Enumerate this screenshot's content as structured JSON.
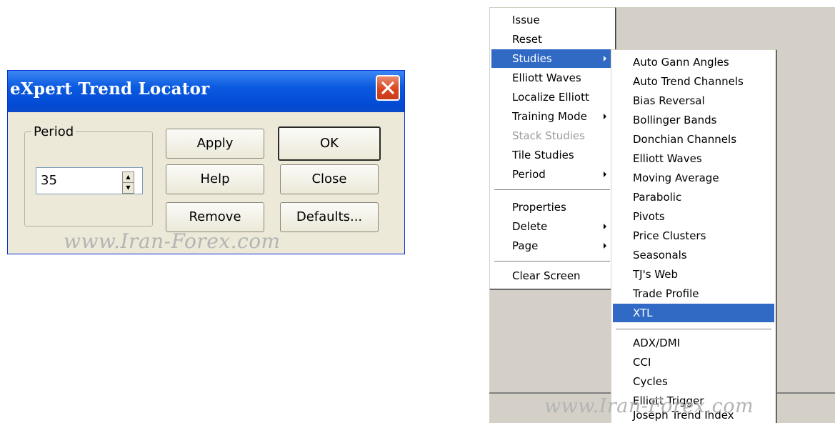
{
  "dialog": {
    "title": "eXpert Trend Locator",
    "period_group_label": "Period",
    "period_value": "35",
    "buttons": {
      "apply": "Apply",
      "ok": "OK",
      "help": "Help",
      "close": "Close",
      "remove": "Remove",
      "defaults": "Defaults..."
    },
    "watermark": "www.Iran-Forex.com"
  },
  "context_menu": {
    "items": [
      {
        "label": "Issue"
      },
      {
        "label": "Reset"
      },
      {
        "label": "Studies",
        "selected": true,
        "submenu": true
      },
      {
        "label": "Elliott Waves"
      },
      {
        "label": "Localize Elliott"
      },
      {
        "label": "Training Mode",
        "submenu": true
      },
      {
        "label": "Stack Studies",
        "disabled": true
      },
      {
        "label": "Tile Studies"
      },
      {
        "label": "Period",
        "submenu": true
      },
      {
        "label": "Properties"
      },
      {
        "label": "Delete",
        "submenu": true
      },
      {
        "label": "Page",
        "submenu": true
      },
      {
        "label": "Clear Screen"
      }
    ]
  },
  "studies_submenu": {
    "items": [
      {
        "label": "Auto Gann Angles"
      },
      {
        "label": "Auto Trend Channels"
      },
      {
        "label": "Bias Reversal"
      },
      {
        "label": "Bollinger Bands"
      },
      {
        "label": "Donchian Channels"
      },
      {
        "label": "Elliott Waves"
      },
      {
        "label": "Moving Average"
      },
      {
        "label": "Parabolic"
      },
      {
        "label": "Pivots"
      },
      {
        "label": "Price Clusters"
      },
      {
        "label": "Seasonals"
      },
      {
        "label": "TJ's Web"
      },
      {
        "label": "Trade Profile"
      },
      {
        "label": "XTL",
        "selected": true
      },
      {
        "label": "ADX/DMI"
      },
      {
        "label": "CCI"
      },
      {
        "label": "Cycles"
      },
      {
        "label": "Elliott Trigger"
      },
      {
        "label": "Joseph Trend Index"
      }
    ]
  },
  "bottom_watermark": "www.Iran-Forex.com",
  "colors": {
    "title_bar": "#0a5ae0",
    "close_button": "#d9451f",
    "dialog_face": "#ece9d8",
    "menu_selection": "#316ac5",
    "disabled_text": "#9b9b9b"
  }
}
